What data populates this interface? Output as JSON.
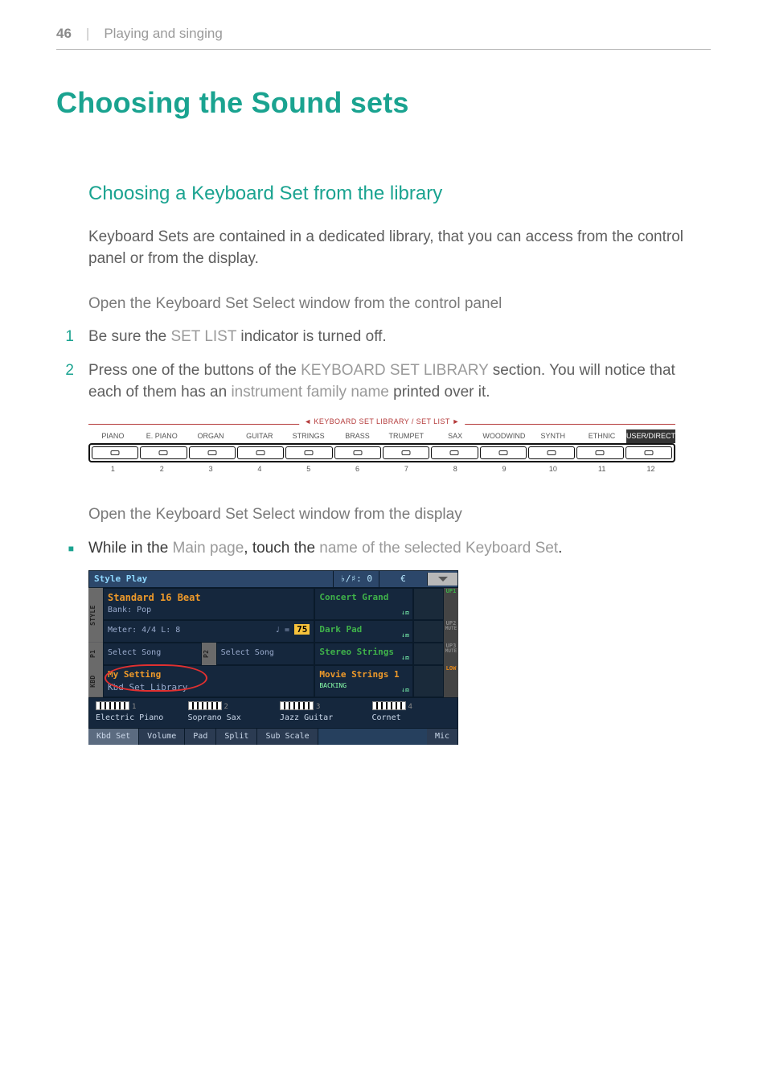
{
  "header": {
    "page_number": "46",
    "separator": "|",
    "section": "Playing and singing"
  },
  "title": "Choosing the Sound sets",
  "sub1": "Choosing a Keyboard Set from the library",
  "intro": "Keyboard Sets are contained in a dedicated library, that you can access from the control panel or from the display.",
  "lead1": "Open the Keyboard Set Select window from the control panel",
  "step1": {
    "num": "1",
    "a": "Be sure the ",
    "b": "SET LIST",
    "c": " indicator is turned off."
  },
  "step2": {
    "num": "2",
    "a": "Press one of the buttons of the ",
    "b": "KEYBOARD SET LIBRARY",
    "c": " section. You will notice that each of them has an ",
    "d": "instrument family name",
    "e": " printed over it."
  },
  "panel": {
    "title": "KEYBOARD SET LIBRARY / SET LIST",
    "labels": [
      "PIANO",
      "E. PIANO",
      "ORGAN",
      "GUITAR",
      "STRINGS",
      "BRASS",
      "TRUMPET",
      "SAX",
      "WOODWIND",
      "SYNTH",
      "ETHNIC",
      "USER/DIRECT"
    ],
    "nums": [
      "1",
      "2",
      "3",
      "4",
      "5",
      "6",
      "7",
      "8",
      "9",
      "10",
      "11",
      "12"
    ]
  },
  "lead2": "Open the Keyboard Set Select window from the display",
  "bullet": {
    "a": "While in the ",
    "b": "Main page",
    "c": ", touch the ",
    "d": "name of the selected Keyboard Set",
    "e": "."
  },
  "display": {
    "titlebar": {
      "mode": "Style Play",
      "trans": "♭/♯: 0",
      "key": "",
      "keyglyph": "€"
    },
    "vleft": [
      "STYLE",
      "P1",
      "KBD"
    ],
    "vright_labels": [
      "UP1",
      "UP2",
      "UP3",
      "LOW"
    ],
    "style_name": "Standard 16 Beat",
    "bank": "Bank: Pop",
    "meter": "Meter:  4/4  L:    8",
    "tempo_prefix": "♩ = ",
    "tempo": "75",
    "p_sel_a": "Select Song",
    "p_mid": "P2",
    "p_sel_b": "Select Song",
    "kbd_sel": "My Setting",
    "kbd_lib": "Kbd Set Library",
    "sounds": [
      "Concert Grand",
      "Dark Pad",
      "Stereo Strings",
      "Movie Strings 1"
    ],
    "backing": "BACKING",
    "mute": "MUTE",
    "icon_small": "↓⧈",
    "kset": {
      "n1": "1",
      "name1": "Electric Piano",
      "n2": "2",
      "name2": "Soprano Sax",
      "n3": "3",
      "name3": "Jazz Guitar",
      "n4": "4",
      "name4": "Cornet"
    },
    "tabs": [
      "Kbd Set",
      "Volume",
      "Pad",
      "Split",
      "Sub Scale",
      "Mic"
    ]
  }
}
